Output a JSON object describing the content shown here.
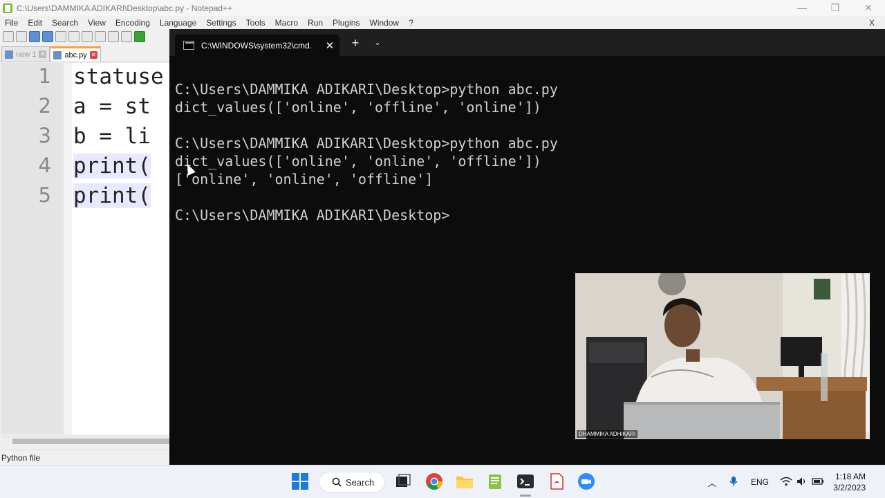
{
  "notepad": {
    "title": "C:\\Users\\DAMMIKA ADIKARI\\Desktop\\abc.py - Notepad++",
    "menu": [
      "File",
      "Edit",
      "Search",
      "View",
      "Encoding",
      "Language",
      "Settings",
      "Tools",
      "Macro",
      "Run",
      "Plugins",
      "Window",
      "?"
    ],
    "menu_close": "X",
    "tabs": [
      {
        "label": "new 1",
        "active": false
      },
      {
        "label": "abc.py",
        "active": true
      }
    ],
    "line_numbers": [
      "1",
      "2",
      "3",
      "4",
      "5"
    ],
    "code_lines": [
      "statuse",
      "a = st",
      "b = li",
      "print(",
      "print("
    ],
    "status_text": "Python file",
    "window_controls": {
      "minimize": "—",
      "restore": "❐",
      "close": "✕"
    }
  },
  "terminal": {
    "tab_title": "C:\\WINDOWS\\system32\\cmd.",
    "tab_close": "✕",
    "new_tab": "+",
    "dropdown": "⌄",
    "lines": [
      "C:\\Users\\DAMMIKA ADIKARI\\Desktop>python abc.py",
      "dict_values(['online', 'offline', 'online'])",
      "",
      "C:\\Users\\DAMMIKA ADIKARI\\Desktop>python abc.py",
      "dict_values(['online', 'online', 'offline'])",
      "['online', 'online', 'offline']",
      "",
      "C:\\Users\\DAMMIKA ADIKARI\\Desktop>"
    ]
  },
  "webcam": {
    "name_label": "DHAMMIKA ADHIKARI"
  },
  "taskbar": {
    "search_label": "Search",
    "apps": [
      "windows-start-icon",
      "task-view-icon",
      "chrome-icon",
      "file-explorer-icon",
      "notepad-plus-plus-icon",
      "terminal-icon",
      "pdf-reader-icon",
      "zoom-icon"
    ],
    "language": "ENG",
    "time": "1:18 AM",
    "date": "3/2/2023"
  },
  "colors": {
    "terminal_bg": "#0c0c0c",
    "terminal_text": "#d0d0d0",
    "npp_tab_accent": "#f9a13a"
  }
}
